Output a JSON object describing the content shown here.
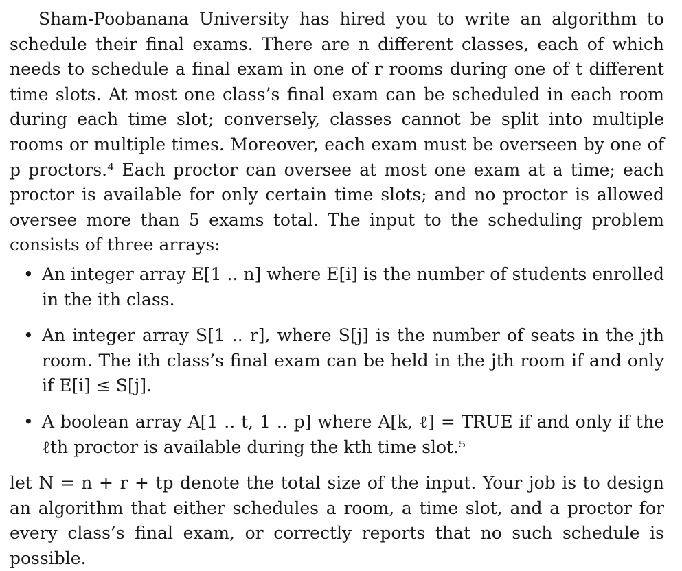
{
  "intro_paragraph": "Sham-Poobanana University has hired you to write an algorithm to schedule their final exams. There are n different classes, each of which needs to schedule a final exam in one of r rooms during one of t different time slots. At most one class’s final exam can be scheduled in each room during each time slot; conversely, classes cannot be split into multiple rooms or multiple times. Moreover, each exam must be overseen by one of p proctors.⁴ Each proctor can oversee at most one exam at a time; each proctor is available for only certain time slots; and no proctor is allowed oversee more than 5 exams total. The input to the scheduling problem consists of three arrays:",
  "bullet_marker": "•",
  "bullets": [
    "An integer array E[1 .. n] where E[i] is the number of students enrolled in the ith class.",
    "An integer array S[1 .. r], where S[j] is the number of seats in the jth room. The ith class’s final exam can be held in the jth room if and only if E[i] ≤ S[j].",
    "A boolean array A[1 .. t, 1 .. p] where A[k, ℓ] = TRUE if and only if the ℓth proctor is available during the kth time slot.⁵"
  ],
  "closing_paragraph": "let N = n + r + tp denote the total size of the input. Your job is to design an algorithm that either schedules a room, a time slot, and a proctor for every class’s final exam, or correctly reports that no such schedule is possible."
}
